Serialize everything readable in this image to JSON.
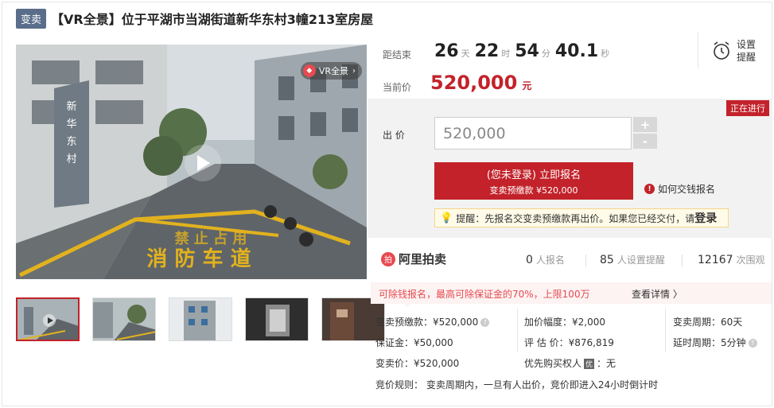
{
  "title": {
    "tag": "变卖",
    "text": "【VR全景】位于平湖市当湖街道新华东村3幢213室房屋"
  },
  "media": {
    "vr_label": "VR全景",
    "sign_text": "新华东村",
    "road_text": "消 防 车 道",
    "road_text2": "禁 止 占 用"
  },
  "countdown": {
    "label": "距结束",
    "days": "26",
    "days_unit": "天",
    "hours": "22",
    "hours_unit": "时",
    "minutes": "54",
    "minutes_unit": "分",
    "seconds": "40.1",
    "seconds_unit": "秒"
  },
  "current_price": {
    "label": "当前价",
    "value": "520,000",
    "unit": "元"
  },
  "reminder": {
    "line1": "设置",
    "line2": "提醒"
  },
  "bid": {
    "status": "正在进行",
    "label": "出 价",
    "input_value": "520,000",
    "plus": "+",
    "minus": "-",
    "signup_main": "(您未登录) 立即报名",
    "signup_sub": "变卖预缴款 ¥520,000",
    "how_pay": "如何交钱报名",
    "tip_prefix": "提醒：先报名交变卖预缴款再出价。如果您已经交付，请",
    "tip_login": "登录"
  },
  "platform": {
    "logo_text": "阿里拍卖"
  },
  "stats": [
    {
      "num": "0",
      "label": "人报名"
    },
    {
      "num": "85",
      "label": "人设置提醒"
    },
    {
      "num": "12167",
      "label": "次围观"
    }
  ],
  "risk": {
    "text": "可除钱报名，最高可除保证金的70%，上限100万",
    "link": "查看详情 〉"
  },
  "details": {
    "deposit": "变卖预缴款：¥520,000",
    "margin": "保证金：¥50,000",
    "sale_price": "变卖价：¥520,000",
    "increment": "加价幅度：¥2,000",
    "appraisal": "评 估 价：¥876,819",
    "priority_prefix": "优先购买权人",
    "priority_tag": "优",
    "priority_value": "：无",
    "period": "变卖周期：60天",
    "delay": "延时周期：5分钟",
    "rule": "竞价规则：   变卖周期内，一旦有人出价，竞价即进入24小时倒计时"
  }
}
